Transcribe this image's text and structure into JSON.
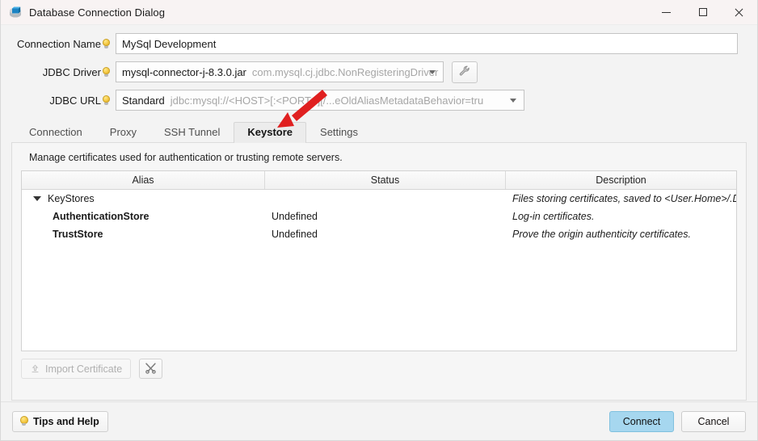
{
  "window": {
    "title": "Database Connection Dialog",
    "icon": "database-icon",
    "controls": {
      "minimize": "minimize-icon",
      "maximize": "maximize-icon",
      "close": "close-icon"
    }
  },
  "form": {
    "connection_name": {
      "label": "Connection Name",
      "hint_icon": "lightbulb-icon",
      "value": "MySql Development",
      "placeholder": ""
    },
    "jdbc_driver": {
      "label": "JDBC Driver",
      "hint_icon": "lightbulb-icon",
      "value": "mysql-connector-j-8.3.0.jar",
      "secondary": "com.mysql.cj.jdbc.NonRegisteringDriver",
      "dropdown_icon": "chevron-down-icon",
      "config_button_icon": "wrench-icon"
    },
    "jdbc_url": {
      "label": "JDBC URL",
      "hint_icon": "lightbulb-icon",
      "value": "Standard",
      "secondary": "jdbc:mysql://<HOST>[:<PORT>][/...eOldAliasMetadataBehavior=tru",
      "dropdown_icon": "chevron-down-icon"
    }
  },
  "tabs": {
    "items": [
      {
        "label": "Connection",
        "active": false
      },
      {
        "label": "Proxy",
        "active": false
      },
      {
        "label": "SSH Tunnel",
        "active": false
      },
      {
        "label": "Keystore",
        "active": true
      },
      {
        "label": "Settings",
        "active": false
      }
    ]
  },
  "keystore_panel": {
    "description": "Manage certificates used for authentication or trusting remote servers.",
    "table": {
      "columns": [
        "Alias",
        "Status",
        "Description"
      ],
      "rows": [
        {
          "alias": "KeyStores",
          "status": "",
          "description": "Files storing certificates, saved to <User.Home>/.DbSc…",
          "level": "root",
          "expander_icon": "triangle-down-icon"
        },
        {
          "alias": "AuthenticationStore",
          "status": "Undefined",
          "description": "Log-in certificates.",
          "level": "child"
        },
        {
          "alias": "TrustStore",
          "status": "Undefined",
          "description": "Prove the origin authenticity certificates.",
          "level": "child"
        }
      ]
    },
    "buttons": {
      "import_certificate": {
        "label": "Import Certificate",
        "icon": "upload-icon",
        "disabled": true
      },
      "tools": {
        "label": "",
        "icon": "crossed-tools-icon"
      }
    }
  },
  "footer": {
    "tips_button": {
      "label": "Tips and Help",
      "icon": "lightbulb-icon"
    },
    "connect_button": {
      "label": "Connect"
    },
    "cancel_button": {
      "label": "Cancel"
    }
  },
  "annotation": {
    "type": "arrow",
    "color": "#e02020",
    "points_to": "Keystore tab"
  },
  "colors": {
    "accent": "#a6d7ef",
    "annotation": "#e02020",
    "window_bg": "#f3f3f3",
    "panel_bg": "#f6f6f6",
    "table_bg": "#ffffff"
  }
}
